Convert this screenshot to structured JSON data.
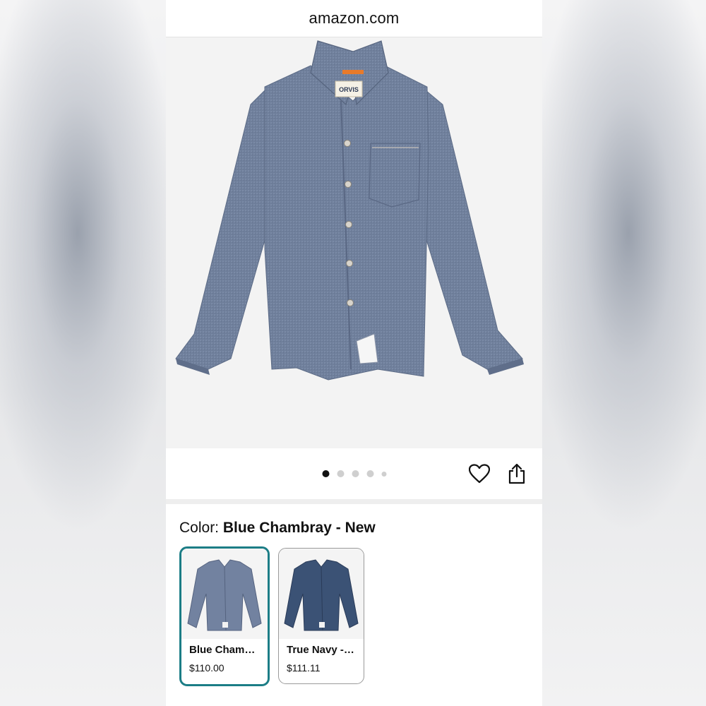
{
  "browser": {
    "url": "amazon.com"
  },
  "product": {
    "image_alt": "Blue chambray long-sleeve button-up shirt",
    "brand_tag": "ORVIS",
    "carousel": {
      "count": 5,
      "active_index": 0
    }
  },
  "actions": {
    "favorite_icon": "heart-icon",
    "share_icon": "share-icon"
  },
  "color": {
    "label": "Color: ",
    "selected_value": "Blue Chambray - New",
    "options": [
      {
        "name": "Blue Cham…",
        "price": "$110.00",
        "selected": true,
        "shirt_color": "#6e7f9c"
      },
      {
        "name": "True Navy - …",
        "price": "$111.11",
        "selected": false,
        "shirt_color": "#3b5275"
      }
    ]
  },
  "colors": {
    "selected_border": "#1c7d86",
    "shirt_main": "#6f7f9b",
    "tag_orange": "#e87a2a"
  }
}
